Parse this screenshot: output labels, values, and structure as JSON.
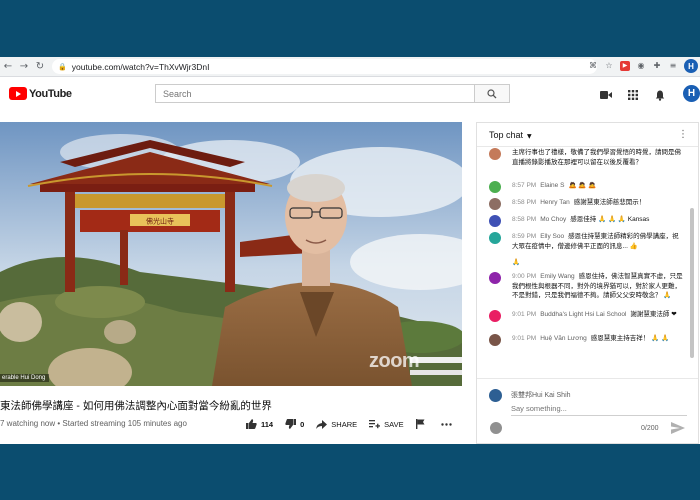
{
  "browser": {
    "url": "youtube.com/watch?v=ThXvWjr3DnI",
    "profile_initial": "H"
  },
  "header": {
    "logo_text": "YouTube",
    "search_placeholder": "Search",
    "avatar_initial": "H"
  },
  "video": {
    "speaker_label": "erable Hui Dong",
    "watermark": "zoom",
    "gate_plaque": "佛光山寺",
    "title": "東法師佛學講座 - 如何用佛法調整內心面對當今紛亂的世界",
    "watching": "7 watching now",
    "streaming": "Started streaming 105 minutes ago",
    "likes": "114",
    "dislikes": "0",
    "share_label": "SHARE",
    "save_label": "SAVE"
  },
  "chat": {
    "mode_label": "Top chat",
    "messages": [
      {
        "time": "",
        "author": "",
        "text": "主席行事也了禮樣，敬備了我們學習覺悟的時覺，請問是佛直播將錄影播放在那裡可以留在以後反覆看？",
        "color": "#c47a5a"
      },
      {
        "time": "8:57 PM",
        "author": "Elaine S",
        "text": "🙇 🙇 🙇",
        "color": "#4caf50"
      },
      {
        "time": "8:58 PM",
        "author": "Henry Tan",
        "text": "感謝慧東法師慈悲開示！",
        "color": "#8d6e63"
      },
      {
        "time": "8:58 PM",
        "author": "Mo Choy",
        "text": "感恩佳持 🙏 🙏 🙏 Kansas",
        "color": "#3f51b5"
      },
      {
        "time": "8:59 PM",
        "author": "Elly Soo",
        "text": "感恩住持慧東法師精彩的佛學講座，祝大眾在疫情中，僧邊修佛平正面的訊息... 👍",
        "color": "#26a69a"
      },
      {
        "time": "",
        "author": "",
        "text": "🙏",
        "color": ""
      },
      {
        "time": "9:00 PM",
        "author": "Emily Wang",
        "text": "感恩住持，佛法智慧真實不虛，只是我們根性與根器不同，對外的境界猶可以，對於家人更難，不是對錯，只是我們福德不夠。請師父父安時敬念？ 🙏",
        "color": "#8e24aa"
      },
      {
        "time": "9:01 PM",
        "author": "Buddha's Light Hsi Lai School",
        "text": "謝謝慧東法師 ❤",
        "color": "#e91e63"
      },
      {
        "time": "9:01 PM",
        "author": "Huệ Văn Lương",
        "text": "感恩慧東主持吉祥！ 🙏 🙏",
        "color": "#795548"
      }
    ],
    "composer": {
      "user_name": "張雙邦Hui Kai Shih",
      "placeholder": "Say something...",
      "char_count": "0/200"
    }
  }
}
